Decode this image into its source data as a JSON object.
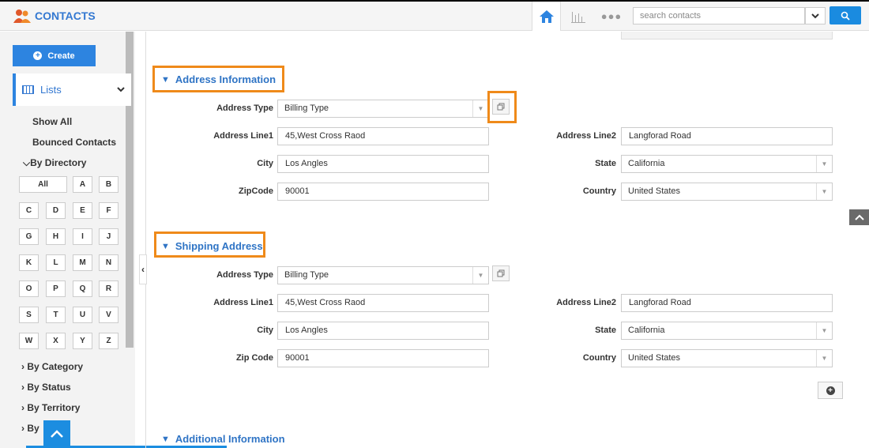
{
  "app": {
    "title": "CONTACTS"
  },
  "header": {
    "search_placeholder": "search contacts",
    "more_label": "●●●"
  },
  "sidebar": {
    "create_label": "Create",
    "lists_label": "Lists",
    "links": [
      "Show All",
      "Bounced Contacts"
    ],
    "by_directory": "By Directory",
    "letters": [
      "All",
      "A",
      "B",
      "C",
      "D",
      "E",
      "F",
      "G",
      "H",
      "I",
      "J",
      "K",
      "L",
      "M",
      "N",
      "O",
      "P",
      "Q",
      "R",
      "S",
      "T",
      "U",
      "V",
      "W",
      "X",
      "Y",
      "Z"
    ],
    "tree": [
      "By Category",
      "By Status",
      "By Territory",
      "By"
    ]
  },
  "address_info": {
    "heading": "Address Information",
    "address_type_label": "Address Type",
    "address_type_value": "Billing Type",
    "line1_label": "Address Line1",
    "line1_value": "45,West Cross Raod",
    "line2_label": "Address Line2",
    "line2_value": "Langforad Road",
    "city_label": "City",
    "city_value": "Los Angles",
    "state_label": "State",
    "state_value": "California",
    "zip_label": "ZipCode",
    "zip_value": "90001",
    "country_label": "Country",
    "country_value": "United States"
  },
  "shipping": {
    "heading": "Shipping Address",
    "address_type_label": "Address Type",
    "address_type_value": "Billing Type",
    "line1_label": "Address Line1",
    "line1_value": "45,West Cross Raod",
    "line2_label": "Address Line2",
    "line2_value": "Langforad Road",
    "city_label": "City",
    "city_value": "Los Angles",
    "state_label": "State",
    "state_value": "California",
    "zip_label": "Zip Code",
    "zip_value": "90001",
    "country_label": "Country",
    "country_value": "United States"
  },
  "additional": {
    "heading": "Additional Information"
  },
  "colors": {
    "accent": "#2d84e0",
    "highlight": "#ef8a1a",
    "link": "#2f74c5"
  }
}
